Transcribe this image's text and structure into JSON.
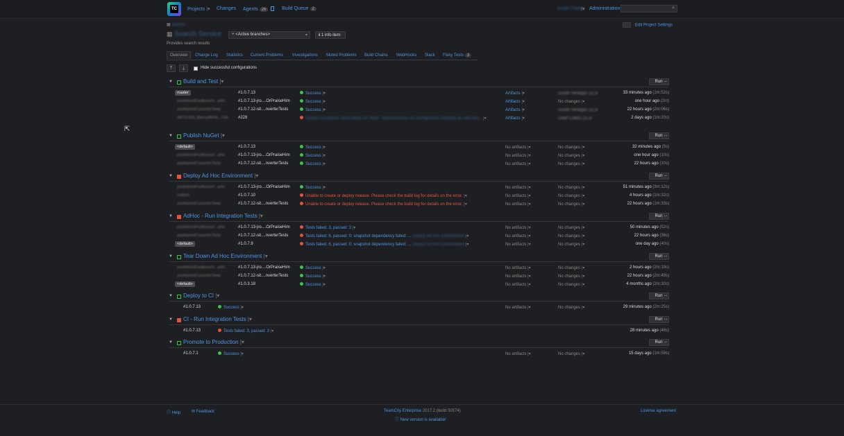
{
  "app": {
    "logo_text": "TC",
    "nav": {
      "projects": "Projects",
      "changes": "Changes",
      "agents": "Agents",
      "agents_count": "26",
      "build_queue": "Build Queue",
      "queue_count": "2",
      "user": "Justin Parker",
      "administration": "Administration"
    },
    "search": {
      "placeholder": ""
    }
  },
  "project": {
    "breadcrumb": "Search",
    "title": "Search Service",
    "branch": "<Active branches>",
    "info_item": "1 info item",
    "description": "Provides search results",
    "edit_settings": "Edit Project Settings"
  },
  "tabs": [
    "Overview",
    "Change Log",
    "Statistics",
    "Current Problems",
    "Investigations",
    "Muted Problems",
    "Build Chains",
    "WebHooks",
    "Slack",
    "Flaky Tests"
  ],
  "flaky_count": "3",
  "hide_successful": "Hide successful configurations",
  "run_label": "Run",
  "more_label": "...",
  "sections": [
    {
      "name": "Build and Test",
      "status": "success",
      "rows": [
        {
          "tag": "master",
          "tag_blur": false,
          "build": "#1.0.7.13",
          "status": "ok",
          "status_text": "Success",
          "artifacts": "Artifacts",
          "changes": "Dustin Venegas (2)",
          "changes_blur": true,
          "time": "33 minutes ago",
          "duration": "(1m:52s)"
        },
        {
          "tag": "predefinedFeatbranch...artin",
          "tag_blur": true,
          "build": "#1.0.7.13-jro....OrPraiseHim",
          "status": "ok",
          "status_text": "Success",
          "artifacts": "Artifacts",
          "changes": "No changes",
          "changes_blur": false,
          "time": "one hour ago",
          "duration": "(2m)"
        },
        {
          "tag": "starMarketConverterTests",
          "tag_blur": true,
          "build": "#1.0.7.12-sit....nverterTests",
          "status": "ok",
          "status_text": "Success",
          "artifacts": "Artifacts",
          "changes": "Dustin Venegas (1)",
          "changes_blur": true,
          "time": "22 hours ago",
          "duration": "(2m:06s)"
        },
        {
          "tag": "SRTX-562_ManualWrite...rVal",
          "tag_blur": true,
          "build": "#228",
          "status": "err",
          "status_text": "System Exception: Build failed on \"build\" SearchService.sln configuration Release at Fake.Bid...",
          "status_blur": true,
          "artifacts": "Artifacts",
          "changes": "Chief Collins (1)",
          "changes_blur": true,
          "time": "2 days ago",
          "duration": "(1m:20s)"
        }
      ]
    },
    {
      "name": "Publish NuGet",
      "status": "success",
      "rows": [
        {
          "tag": "<default>",
          "tag_blur": false,
          "build": "#1.0.7.13",
          "status": "ok",
          "status_text": "Success",
          "artifacts": "No artifacts",
          "changes": "No changes",
          "time": "32 minutes ago",
          "duration": "(5s)"
        },
        {
          "tag": "predefinedFeatbranch...artin",
          "tag_blur": true,
          "build": "#1.0.7.13-jro....OrPraiseHim",
          "status": "ok",
          "status_text": "Success",
          "artifacts": "No artifacts",
          "changes": "No changes",
          "time": "one hour ago",
          "duration": "(10s)"
        },
        {
          "tag": "starMarketConverterTests",
          "tag_blur": true,
          "build": "#1.0.7.12-sit....nverterTests",
          "status": "ok",
          "status_text": "Success",
          "artifacts": "No artifacts",
          "changes": "No changes",
          "time": "22 hours ago",
          "duration": "(10s)"
        }
      ]
    },
    {
      "name": "Deploy Ad Hoc Environment",
      "status": "failed",
      "rows": [
        {
          "tag": "predefinedFeatbranch...artin",
          "tag_blur": true,
          "build": "#1.0.7.13-jro....OrPraiseHim",
          "status": "ok",
          "status_text": "Success",
          "artifacts": "No artifacts",
          "changes": "No changes",
          "time": "51 minutes ago",
          "duration": "(3m:12s)"
        },
        {
          "tag": "hotfix/0",
          "tag_blur": true,
          "build": "#1.0.7.10",
          "status": "err",
          "status_text": "Unable to create or deploy release. Please check the build log for details on the error.",
          "artifacts": "No artifacts",
          "changes": "No changes",
          "time": "4 hours ago",
          "duration": "(1m:32s)"
        },
        {
          "tag": "starMarketConverterTests",
          "tag_blur": true,
          "build": "#1.0.7.12-sit....nverterTests",
          "status": "err",
          "status_text": "Unable to create or deploy release. Please check the build log for details on the error.",
          "artifacts": "No artifacts",
          "changes": "No changes",
          "time": "22 hours ago",
          "duration": "(1m:33s)"
        }
      ]
    },
    {
      "name": "AdHoc - Run Integration Tests",
      "status": "failed",
      "rows": [
        {
          "tag": "predefinedFeatbranch...artin",
          "tag_blur": true,
          "build": "#1.0.7.13-jro....OrPraiseHim",
          "status": "err",
          "status_text": "Tests failed: 3, passed: 3",
          "artifacts": "No artifacts",
          "changes": "No changes",
          "time": "50 minutes ago",
          "duration": "(52s)"
        },
        {
          "tag": "starMarketConverterTests",
          "tag_blur": true,
          "build": "#1.0.7.12-sit....nverterTests",
          "status": "err",
          "status_text": "Tests failed: 6, passed: 0; snapshot dependency failed: ...",
          "status_suffix": "Deploy Ad Hoc Environment",
          "artifacts": "No artifacts",
          "changes": "No changes",
          "time": "22 hours ago",
          "duration": "(36s)"
        },
        {
          "tag": "<default>",
          "tag_blur": false,
          "build": "#1.0.7.9",
          "status": "err",
          "status_text": "Tests failed: 6, passed: 0; snapshot dependency failed: ...",
          "status_suffix": "Deploy Ad Hoc Environment",
          "artifacts": "No artifacts",
          "changes": "No changes",
          "time": "one day ago",
          "duration": "(40s)"
        }
      ]
    },
    {
      "name": "Tear Down Ad Hoc Environment",
      "status": "success",
      "rows": [
        {
          "tag": "predefinedFeatbranch...artin",
          "tag_blur": true,
          "build": "#1.0.7.13-jro....OrPraiseHim",
          "status": "ok",
          "status_text": "Success",
          "artifacts": "No artifacts",
          "changes": "No changes",
          "time": "2 hours ago",
          "duration": "(2m:19s)"
        },
        {
          "tag": "starMarketConverterTests",
          "tag_blur": true,
          "build": "#1.0.7.12-sit....nverterTests",
          "status": "ok",
          "status_text": "Success",
          "artifacts": "No artifacts",
          "changes": "No changes",
          "time": "22 hours ago",
          "duration": "(2m:49s)"
        },
        {
          "tag": "<default>",
          "tag_blur": false,
          "build": "#1.0.3.18",
          "status": "ok",
          "status_text": "Success",
          "artifacts": "No artifacts",
          "changes": "No changes",
          "time": "4 months ago",
          "duration": "(2m:30s)"
        }
      ]
    },
    {
      "name": "Deploy to CI",
      "status": "success",
      "rows": [
        {
          "tag": "",
          "tag_blur": false,
          "build": "#1.0.7.13",
          "status": "ok",
          "status_text": "Success",
          "artifacts": "No artifacts",
          "changes": "No changes",
          "time": "29 minutes ago",
          "duration": "(2m:25s)",
          "compact": true
        }
      ]
    },
    {
      "name": "CI - Run Integration Tests",
      "status": "failed",
      "rows": [
        {
          "tag": "",
          "tag_blur": false,
          "build": "#1.0.7.13",
          "status": "err",
          "status_text": "Tests failed: 3, passed: 3",
          "artifacts": "",
          "changes": "",
          "time": "28 minutes ago",
          "duration": "(46s)",
          "compact": true
        }
      ]
    },
    {
      "name": "Promote to Production",
      "status": "success",
      "rows": [
        {
          "tag": "",
          "tag_blur": false,
          "build": "#1.0.7.1",
          "status": "ok",
          "status_text": "Success",
          "artifacts": "No artifacts",
          "changes": "No changes",
          "time": "15 days ago",
          "duration": "(1m:59s)",
          "compact": true
        }
      ]
    }
  ],
  "footer": {
    "help": "Help",
    "feedback": "Feedback",
    "product": "TeamCity Enterprise",
    "version": "2017.2 (build 50574)",
    "new_version": "New version is available!",
    "license": "License agreement"
  },
  "colors": {
    "background": "#1e1f22",
    "link": "#4f95e0",
    "success": "#3ec24b",
    "failure": "#e5533c"
  }
}
